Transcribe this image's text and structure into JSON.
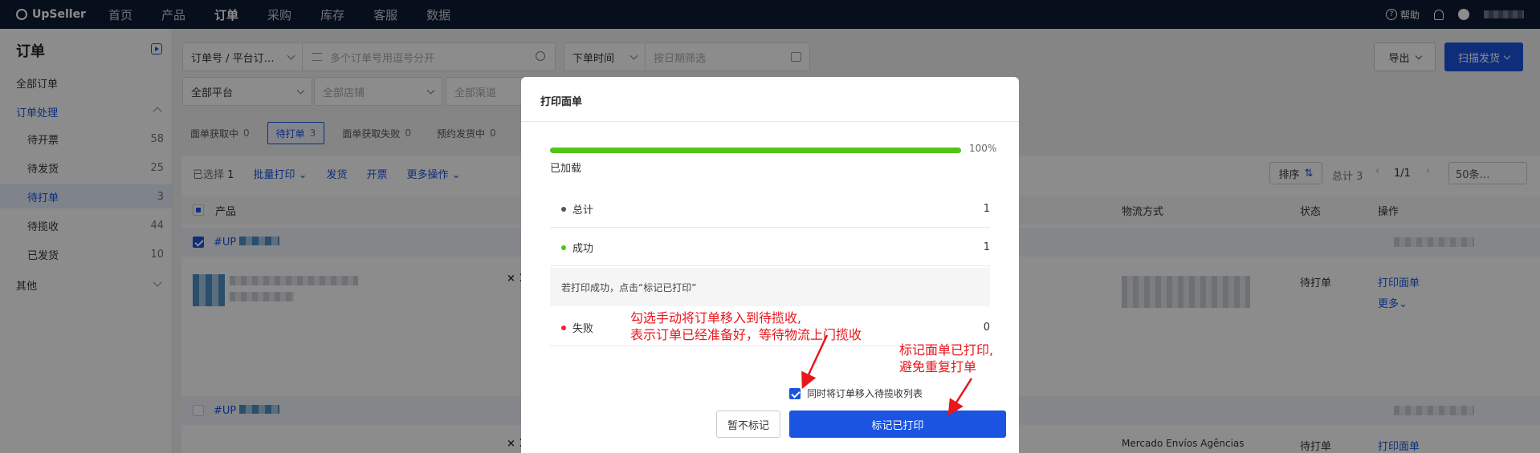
{
  "topnav": {
    "brand": "UpSeller",
    "items": [
      "首页",
      "产品",
      "订单",
      "采购",
      "库存",
      "客服",
      "数据"
    ],
    "active_index": 2,
    "help": "帮助"
  },
  "sidebar": {
    "title": "订单",
    "all_orders": "全部订单",
    "group_label": "订单处理",
    "sub_items": [
      {
        "label": "待开票",
        "count": "58"
      },
      {
        "label": "待发货",
        "count": "25"
      },
      {
        "label": "待打单",
        "count": "3"
      },
      {
        "label": "待揽收",
        "count": "44"
      },
      {
        "label": "已发货",
        "count": "10"
      }
    ],
    "active_sub_index": 2,
    "other": "其他"
  },
  "filters": {
    "order_no_select": "订单号 / 平台订…",
    "order_no_placeholder": "多个订单号用逗号分开",
    "time_select": "下单时间",
    "date_placeholder": "按日期筛选",
    "platform": "全部平台",
    "shop": "全部店铺",
    "channel": "全部渠道",
    "export": "导出",
    "scan_ship": "扫描发货"
  },
  "tabs": [
    {
      "label": "面单获取中",
      "count": "0"
    },
    {
      "label": "待打单",
      "count": "3"
    },
    {
      "label": "面单获取失败",
      "count": "0"
    },
    {
      "label": "预约发货中",
      "count": "0"
    }
  ],
  "toolbar": {
    "selected": "已选择",
    "selected_count": "1",
    "batch_print": "批量打印",
    "ship": "发货",
    "invoice": "开票",
    "more": "更多操作",
    "sort": "排序",
    "total": "总计 3",
    "page": "1/1",
    "per_page": "50条…"
  },
  "table": {
    "columns": {
      "product": "产品",
      "logistics": "物流方式",
      "status": "状态",
      "action": "操作"
    },
    "order1_prefix": "#UP",
    "order2_prefix": "#UP",
    "qty": "× 1",
    "status_value": "待打单",
    "action_print": "打印面单",
    "action_more": "更多",
    "logistics_row2": "Mercado Envíos Agências"
  },
  "modal": {
    "title": "打印面单",
    "progress": 1.0,
    "progress_text": "100%",
    "loaded": "已加载",
    "stats": [
      {
        "label": "总计",
        "value": "1",
        "color": "#555555"
      },
      {
        "label": "成功",
        "value": "1",
        "color": "#52c41a"
      },
      {
        "label": "失败",
        "value": "0",
        "color": "#f5222d"
      }
    ],
    "hint": "若打印成功，点击“标记已打印”",
    "move_checkbox_label": "同时将订单移入待揽收列表",
    "move_checked": true,
    "btn_skip": "暂不标记",
    "btn_mark": "标记已打印"
  },
  "annotations": {
    "left_line1": "勾选手动将订单移入到待揽收,",
    "left_line2": "表示订单已经准备好，等待物流上门揽收",
    "right_line1": "标记面单已打印,",
    "right_line2": "避免重复打单",
    "color": "#e8161d"
  }
}
